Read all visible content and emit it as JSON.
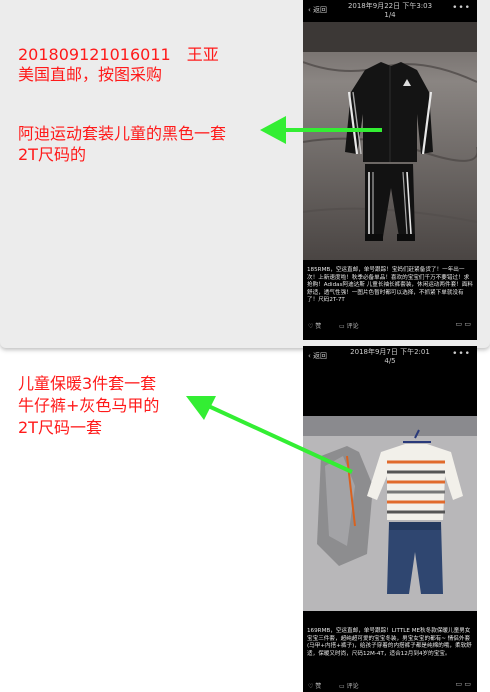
{
  "notes": {
    "order_line1": "201809121016011　王亚",
    "order_line2": "美国直邮，按图采购",
    "item1_line1": "阿迪运动套装儿童的黑色一套",
    "item1_line2": "2T尺码的",
    "item2_line1": "儿童保暖3件套一套",
    "item2_line2": "牛仔裤+灰色马甲的",
    "item2_line3": "2T尺码一套"
  },
  "colors": {
    "note_text": "#ff1a1a",
    "arrow": "#33ee33"
  },
  "post1": {
    "back": "返回",
    "timestamp": "2018年9月22日 下午3:03",
    "page": "1/4",
    "caption": "185RMB，空运直邮，单号跟踪！宝妈们赶紧备货了！一年出一次！上新速度啦！秋季必备单品！喜欢的宝宝们千万不要错过！求抢购！Adidas阿迪达斯 儿童长袖长裤套装，休闲运动两件套！面料舒适，透气性强！一图片色暂时都可以选择，不抓紧下单就没有了！尺码2T-7T",
    "like": "赞",
    "comment": "评论"
  },
  "post2": {
    "back": "返回",
    "timestamp": "2018年9月7日 下午2:01",
    "page": "4/5",
    "caption": "169RMB，空运直邮，单号跟踪！LITTLE ME秋冬款保暖儿童男女宝宝三件套，超纯超可爱的宝宝冬装，男宝女宝的都有~ 情侣外套(马甲+内搭+裤子)，给孩子穿着的内搭裤子都是纯棉的哦，柔软舒适，保暖又时尚，尺码12M-4T，适合12月到4岁的宝宝。",
    "like": "赞",
    "comment": "评论"
  }
}
